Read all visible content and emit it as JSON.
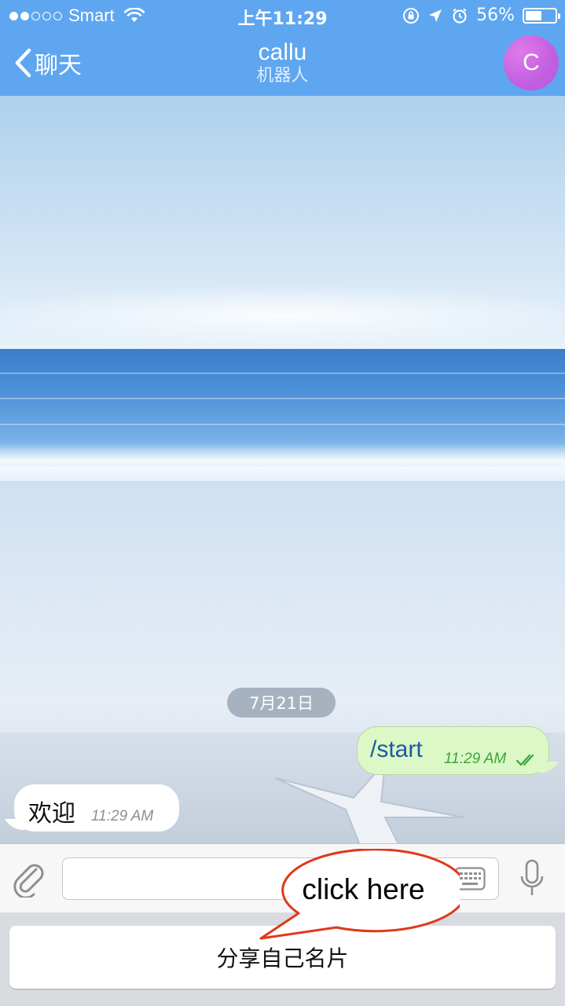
{
  "status_bar": {
    "carrier": "Smart",
    "time": "上午11:29",
    "battery_percent": "56%",
    "battery_level": 0.56
  },
  "nav": {
    "back_label": "聊天",
    "title": "callu",
    "subtitle": "机器人",
    "avatar_letter": "C"
  },
  "chat": {
    "date_chip": "7月21日",
    "messages": [
      {
        "direction": "outgoing",
        "text": "/start",
        "time": "11:29 AM",
        "read": true
      },
      {
        "direction": "incoming",
        "text": "欢迎",
        "time": "11:29 AM"
      }
    ]
  },
  "input_bar": {
    "value": "",
    "icons": [
      "paperclip-icon",
      "keyboard-icon",
      "microphone-icon"
    ]
  },
  "bot_keyboard": {
    "buttons": [
      "分享自己名片"
    ]
  },
  "annotation": {
    "callout_text": "click here",
    "color": "#e0381a"
  },
  "colors": {
    "header": "#5ea6f0",
    "outgoing_bubble": "#dcf8c6",
    "outgoing_text": "#1e58a5",
    "outgoing_time": "#3fa53a",
    "avatar": "#c25fe0"
  }
}
